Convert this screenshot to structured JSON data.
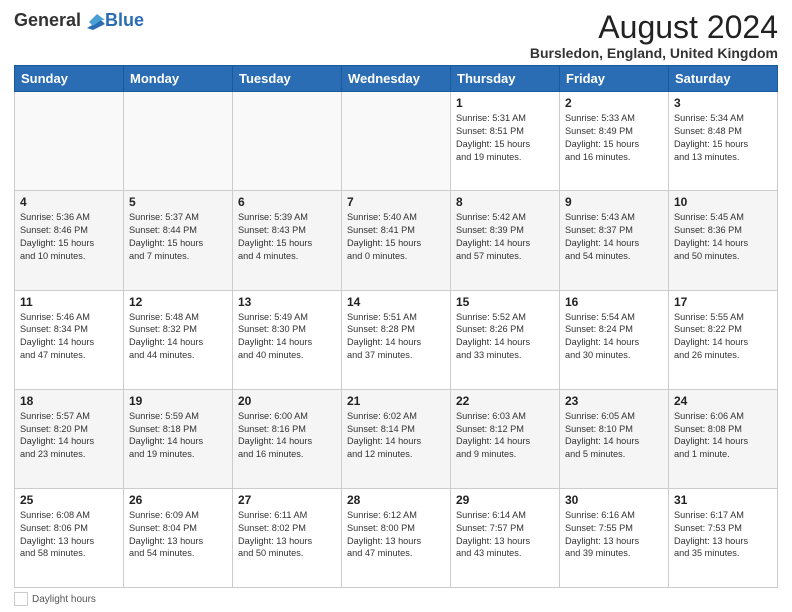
{
  "header": {
    "logo_general": "General",
    "logo_blue": "Blue",
    "main_title": "August 2024",
    "subtitle": "Bursledon, England, United Kingdom"
  },
  "calendar": {
    "headers": [
      "Sunday",
      "Monday",
      "Tuesday",
      "Wednesday",
      "Thursday",
      "Friday",
      "Saturday"
    ],
    "weeks": [
      [
        {
          "day": "",
          "info": ""
        },
        {
          "day": "",
          "info": ""
        },
        {
          "day": "",
          "info": ""
        },
        {
          "day": "",
          "info": ""
        },
        {
          "day": "1",
          "info": "Sunrise: 5:31 AM\nSunset: 8:51 PM\nDaylight: 15 hours\nand 19 minutes."
        },
        {
          "day": "2",
          "info": "Sunrise: 5:33 AM\nSunset: 8:49 PM\nDaylight: 15 hours\nand 16 minutes."
        },
        {
          "day": "3",
          "info": "Sunrise: 5:34 AM\nSunset: 8:48 PM\nDaylight: 15 hours\nand 13 minutes."
        }
      ],
      [
        {
          "day": "4",
          "info": "Sunrise: 5:36 AM\nSunset: 8:46 PM\nDaylight: 15 hours\nand 10 minutes."
        },
        {
          "day": "5",
          "info": "Sunrise: 5:37 AM\nSunset: 8:44 PM\nDaylight: 15 hours\nand 7 minutes."
        },
        {
          "day": "6",
          "info": "Sunrise: 5:39 AM\nSunset: 8:43 PM\nDaylight: 15 hours\nand 4 minutes."
        },
        {
          "day": "7",
          "info": "Sunrise: 5:40 AM\nSunset: 8:41 PM\nDaylight: 15 hours\nand 0 minutes."
        },
        {
          "day": "8",
          "info": "Sunrise: 5:42 AM\nSunset: 8:39 PM\nDaylight: 14 hours\nand 57 minutes."
        },
        {
          "day": "9",
          "info": "Sunrise: 5:43 AM\nSunset: 8:37 PM\nDaylight: 14 hours\nand 54 minutes."
        },
        {
          "day": "10",
          "info": "Sunrise: 5:45 AM\nSunset: 8:36 PM\nDaylight: 14 hours\nand 50 minutes."
        }
      ],
      [
        {
          "day": "11",
          "info": "Sunrise: 5:46 AM\nSunset: 8:34 PM\nDaylight: 14 hours\nand 47 minutes."
        },
        {
          "day": "12",
          "info": "Sunrise: 5:48 AM\nSunset: 8:32 PM\nDaylight: 14 hours\nand 44 minutes."
        },
        {
          "day": "13",
          "info": "Sunrise: 5:49 AM\nSunset: 8:30 PM\nDaylight: 14 hours\nand 40 minutes."
        },
        {
          "day": "14",
          "info": "Sunrise: 5:51 AM\nSunset: 8:28 PM\nDaylight: 14 hours\nand 37 minutes."
        },
        {
          "day": "15",
          "info": "Sunrise: 5:52 AM\nSunset: 8:26 PM\nDaylight: 14 hours\nand 33 minutes."
        },
        {
          "day": "16",
          "info": "Sunrise: 5:54 AM\nSunset: 8:24 PM\nDaylight: 14 hours\nand 30 minutes."
        },
        {
          "day": "17",
          "info": "Sunrise: 5:55 AM\nSunset: 8:22 PM\nDaylight: 14 hours\nand 26 minutes."
        }
      ],
      [
        {
          "day": "18",
          "info": "Sunrise: 5:57 AM\nSunset: 8:20 PM\nDaylight: 14 hours\nand 23 minutes."
        },
        {
          "day": "19",
          "info": "Sunrise: 5:59 AM\nSunset: 8:18 PM\nDaylight: 14 hours\nand 19 minutes."
        },
        {
          "day": "20",
          "info": "Sunrise: 6:00 AM\nSunset: 8:16 PM\nDaylight: 14 hours\nand 16 minutes."
        },
        {
          "day": "21",
          "info": "Sunrise: 6:02 AM\nSunset: 8:14 PM\nDaylight: 14 hours\nand 12 minutes."
        },
        {
          "day": "22",
          "info": "Sunrise: 6:03 AM\nSunset: 8:12 PM\nDaylight: 14 hours\nand 9 minutes."
        },
        {
          "day": "23",
          "info": "Sunrise: 6:05 AM\nSunset: 8:10 PM\nDaylight: 14 hours\nand 5 minutes."
        },
        {
          "day": "24",
          "info": "Sunrise: 6:06 AM\nSunset: 8:08 PM\nDaylight: 14 hours\nand 1 minute."
        }
      ],
      [
        {
          "day": "25",
          "info": "Sunrise: 6:08 AM\nSunset: 8:06 PM\nDaylight: 13 hours\nand 58 minutes."
        },
        {
          "day": "26",
          "info": "Sunrise: 6:09 AM\nSunset: 8:04 PM\nDaylight: 13 hours\nand 54 minutes."
        },
        {
          "day": "27",
          "info": "Sunrise: 6:11 AM\nSunset: 8:02 PM\nDaylight: 13 hours\nand 50 minutes."
        },
        {
          "day": "28",
          "info": "Sunrise: 6:12 AM\nSunset: 8:00 PM\nDaylight: 13 hours\nand 47 minutes."
        },
        {
          "day": "29",
          "info": "Sunrise: 6:14 AM\nSunset: 7:57 PM\nDaylight: 13 hours\nand 43 minutes."
        },
        {
          "day": "30",
          "info": "Sunrise: 6:16 AM\nSunset: 7:55 PM\nDaylight: 13 hours\nand 39 minutes."
        },
        {
          "day": "31",
          "info": "Sunrise: 6:17 AM\nSunset: 7:53 PM\nDaylight: 13 hours\nand 35 minutes."
        }
      ]
    ]
  },
  "footer": {
    "daylight_label": "Daylight hours"
  }
}
